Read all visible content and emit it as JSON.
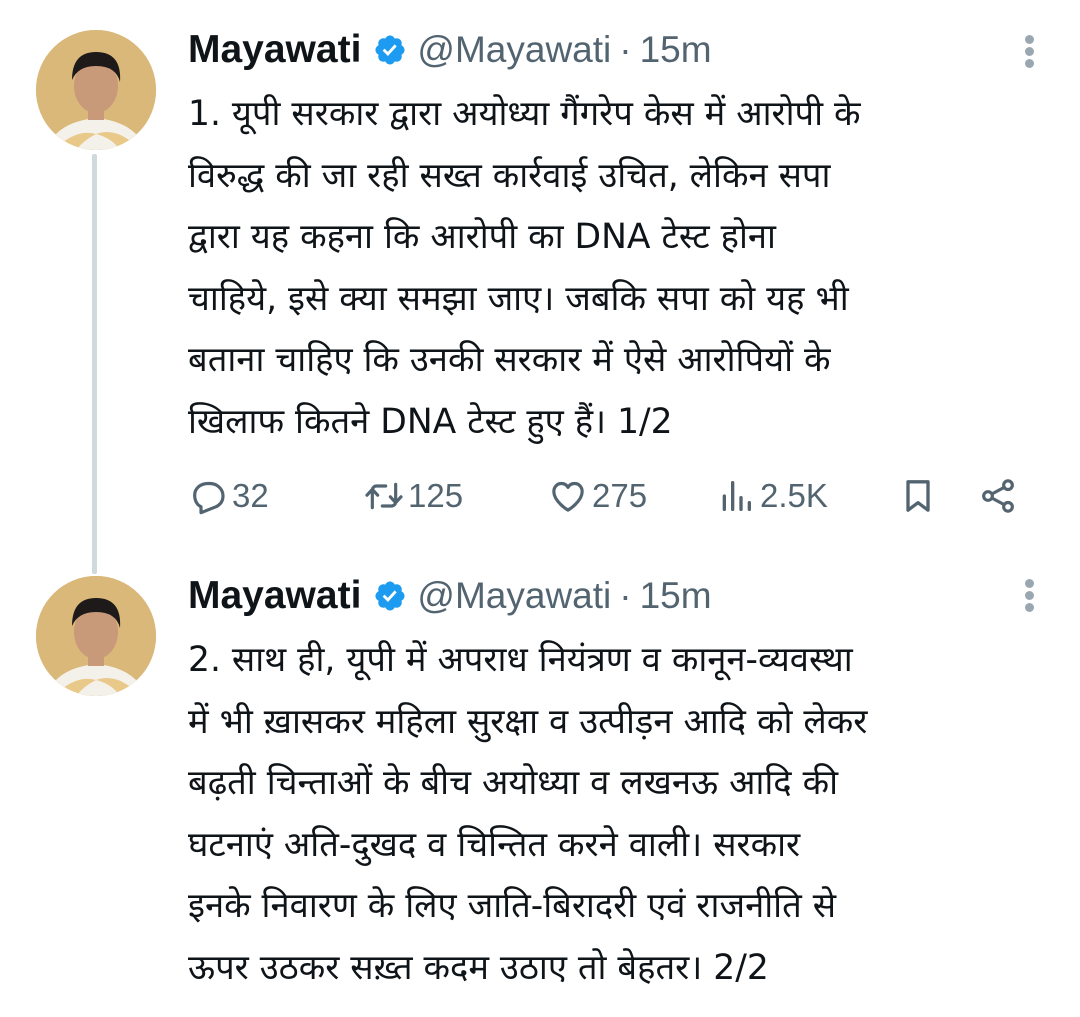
{
  "colors": {
    "text": "#0f1419",
    "muted": "#536471",
    "verified": "#1d9bf0",
    "thread_line": "#cfd9de"
  },
  "tweets": [
    {
      "author": "Mayawati",
      "handle": "@Mayawati",
      "separator": "·",
      "time": "15m",
      "lines": [
        "1. यूपी सरकार द्वारा अयोध्या गैंगरेप केस में आरोपी के",
        "विरुद्ध की जा रही सख्त कार्रवाई उचित, लेकिन सपा",
        "द्वारा यह कहना कि आरोपी का DNA टेस्ट होना",
        "चाहिये, इसे क्या समझा जाए। जबकि सपा को यह भी",
        "बताना चाहिए कि उनकी सरकार में ऐसे आरोपियों के",
        "खिलाफ कितने DNA टेस्ट हुए हैं। 1/2"
      ],
      "stats": {
        "replies": "32",
        "reposts": "125",
        "likes": "275",
        "views": "2.5K"
      }
    },
    {
      "author": "Mayawati",
      "handle": "@Mayawati",
      "separator": "·",
      "time": "15m",
      "lines": [
        "2. साथ ही, यूपी में अपराध नियंत्रण व कानून-व्यवस्था",
        "में भी ख़ासकर महिला सुरक्षा व उत्पीड़न आदि को लेकर",
        "बढ़ती चिन्ताओं के बीच अयोध्या व लखनऊ आदि की",
        "घटनाएं अति-दुखद व चिन्तित करने वाली। सरकार",
        "इनके निवारण के लिए जाति-बिरादरी एवं राजनीति से",
        "ऊपर उठकर सख़्त कदम उठाए तो बेहतर। 2/2"
      ]
    }
  ],
  "icons": [
    "verified-badge-icon",
    "more-vertical-icon",
    "reply-icon",
    "retweet-icon",
    "like-icon",
    "views-icon",
    "bookmark-icon",
    "share-icon"
  ]
}
